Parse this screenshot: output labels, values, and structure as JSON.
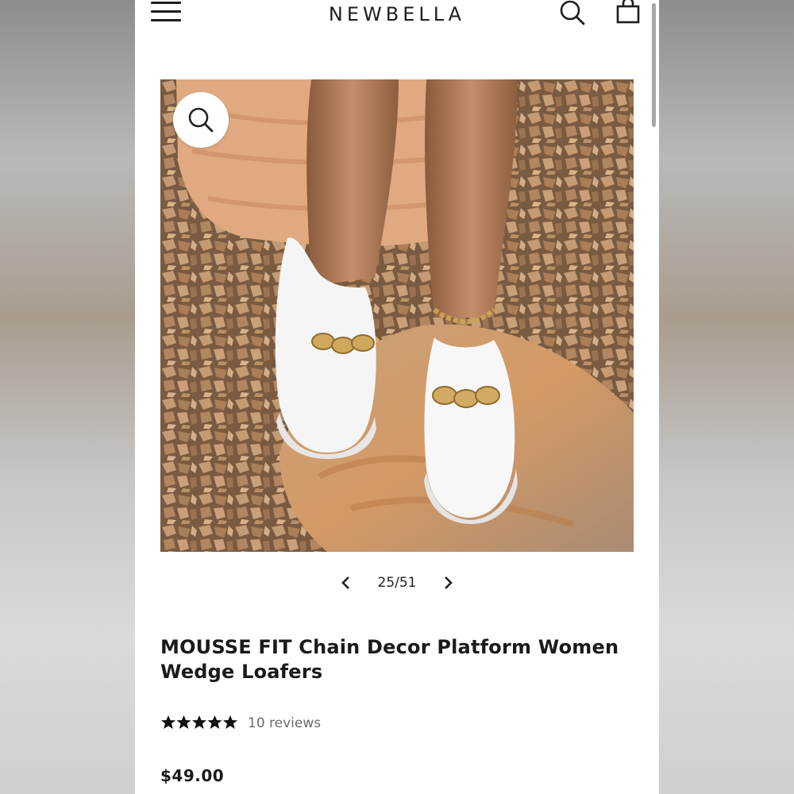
{
  "header": {
    "brand": "NEWBELLA",
    "menu_icon": "hamburger-menu-icon",
    "search_icon": "search-icon",
    "cart_icon": "shopping-bag-icon"
  },
  "gallery": {
    "current": "25/51",
    "zoom_icon": "zoom-magnifier-icon",
    "prev_icon": "chevron-left-icon",
    "next_icon": "chevron-right-icon"
  },
  "product": {
    "title": "MOUSSE FIT Chain Decor Platform Women Wedge Loafers",
    "rating": 5,
    "rating_max": 5,
    "reviews_label": "10 reviews",
    "price": "$49.00"
  },
  "colors": {
    "text": "#1a1a1a",
    "muted": "#6b6b6b",
    "background": "#ffffff"
  }
}
